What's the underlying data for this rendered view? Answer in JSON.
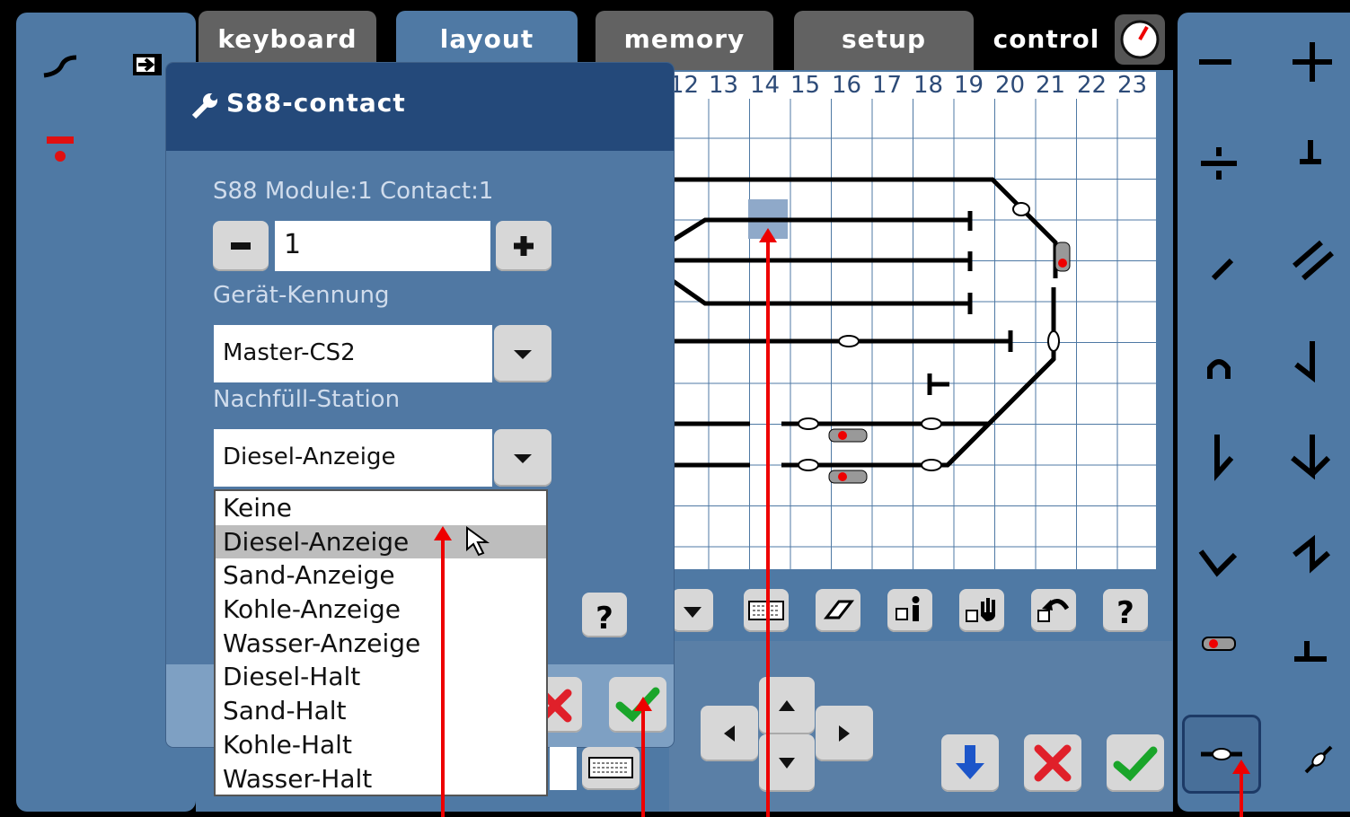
{
  "tabs": {
    "keyboard": "keyboard",
    "layout": "layout",
    "memory": "memory",
    "setup": "setup",
    "control": "control"
  },
  "dialog": {
    "title": "S88-contact",
    "module_contact": "S88 Module:1 Contact:1",
    "stepper_value": "1",
    "device_label": "Gerät-Kennung",
    "device_value": "Master-CS2",
    "station_label": "Nachfüll-Station",
    "station_value": "Diesel-Anzeige",
    "options": [
      "Keine",
      "Diesel-Anzeige",
      "Sand-Anzeige",
      "Kohle-Anzeige",
      "Wasser-Anzeige",
      "Diesel-Halt",
      "Sand-Halt",
      "Kohle-Halt",
      "Wasser-Halt"
    ],
    "selected_index": 1
  },
  "grid": {
    "columns": [
      "12",
      "13",
      "14",
      "15",
      "16",
      "17",
      "18",
      "19",
      "20",
      "21",
      "22",
      "23"
    ]
  },
  "colors": {
    "panel": "#4f79a4",
    "header": "#24497a",
    "annotation_red": "#e00000",
    "confirm_green": "#1aa52a",
    "cancel_red": "#e0202a",
    "down_blue": "#1c55c9"
  },
  "icons": {
    "control": "gauge-icon",
    "title": "wrench-icon",
    "help": "question-icon",
    "keyboard": "keyboard-icon",
    "eraser": "eraser-icon",
    "info": "info-icon",
    "hand": "hand-icon",
    "undo": "undo-icon"
  }
}
